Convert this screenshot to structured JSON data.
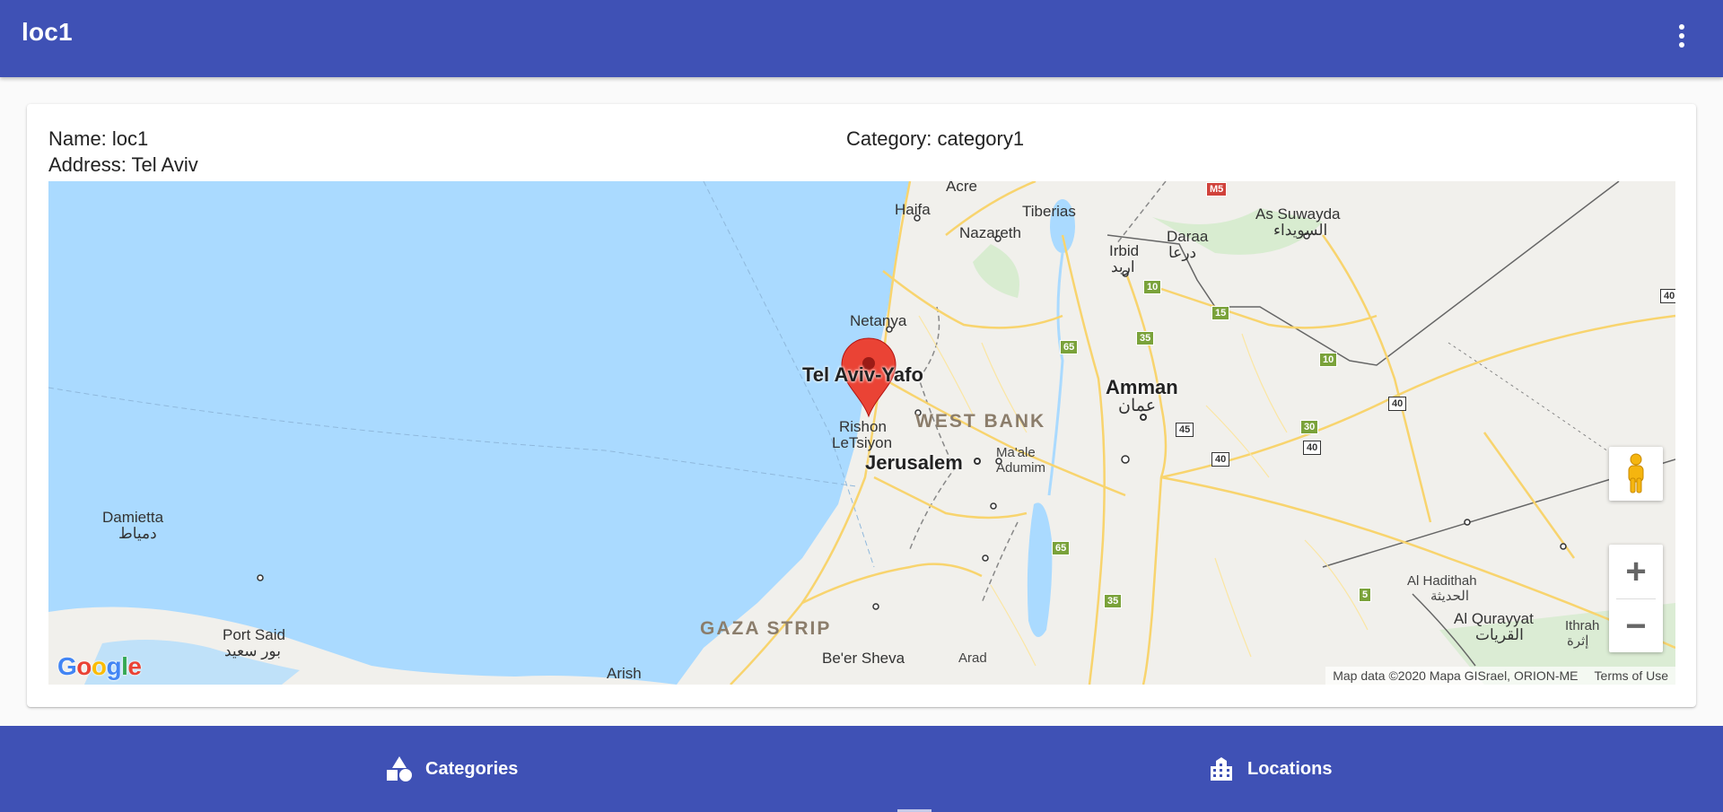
{
  "app_bar": {
    "title": "loc1",
    "menu_icon": "more-vert-icon"
  },
  "details": {
    "name": "Name: loc1",
    "address": "Address: Tel Aviv",
    "category": "Category: category1"
  },
  "map": {
    "labels": {
      "acre": "Acre",
      "haifa": "Haifa",
      "tiberias": "Tiberias",
      "nazareth": "Nazareth",
      "daraa": "Daraa",
      "daraa_ar": "درعا",
      "irbid": "Irbid",
      "irbid_ar": "اربد",
      "as_suwayda": "As Suwayda",
      "as_suwayda_ar": "السويداء",
      "netanya": "Netanya",
      "tel_aviv": "Tel Aviv-Yafo",
      "amman": "Amman",
      "amman_ar": "عمان",
      "rishon": "Rishon",
      "letsiyon": "LeTsiyon",
      "west_bank": "WEST BANK",
      "jerusalem": "Jerusalem",
      "maale": "Ma'ale",
      "adumim": "Adumim",
      "damietta": "Damietta",
      "damietta_ar": "دمياط",
      "port_said": "Port Said",
      "port_said_ar": "بور سعيد",
      "gaza_strip": "GAZA STRIP",
      "beer_sheva": "Be'er Sheva",
      "arad": "Arad",
      "arish": "Arish",
      "al_hadithah": "Al Hadithah",
      "al_hadithah_ar": "الحديثة",
      "al_qurayyat": "Al Qurayyat",
      "al_qurayyat_ar": "القريات",
      "ithrah": "Ithrah",
      "ithrah_ar": "إثرة"
    },
    "shields": {
      "m5": "M5",
      "r10a": "10",
      "r15": "15",
      "r35a": "35",
      "r65a": "65",
      "r10b": "10",
      "r40a": "40",
      "r45": "45",
      "r30": "30",
      "r40b": "40",
      "r40c": "40",
      "r65b": "65",
      "r35b": "35",
      "r5": "5",
      "r40d": "40"
    },
    "google_logo": "Google",
    "attribution": "Map data ©2020 Mapa GISrael, ORION-ME",
    "terms": "Terms of Use",
    "zoom_in": "+",
    "zoom_out": "−",
    "colors": {
      "water": "#aadaff",
      "land": "#f1f0ec",
      "road": "#f8d46e",
      "park": "#cde9c4",
      "marker": "#ea4335"
    }
  },
  "bottom_nav": {
    "categories_label": "Categories",
    "locations_label": "Locations"
  }
}
